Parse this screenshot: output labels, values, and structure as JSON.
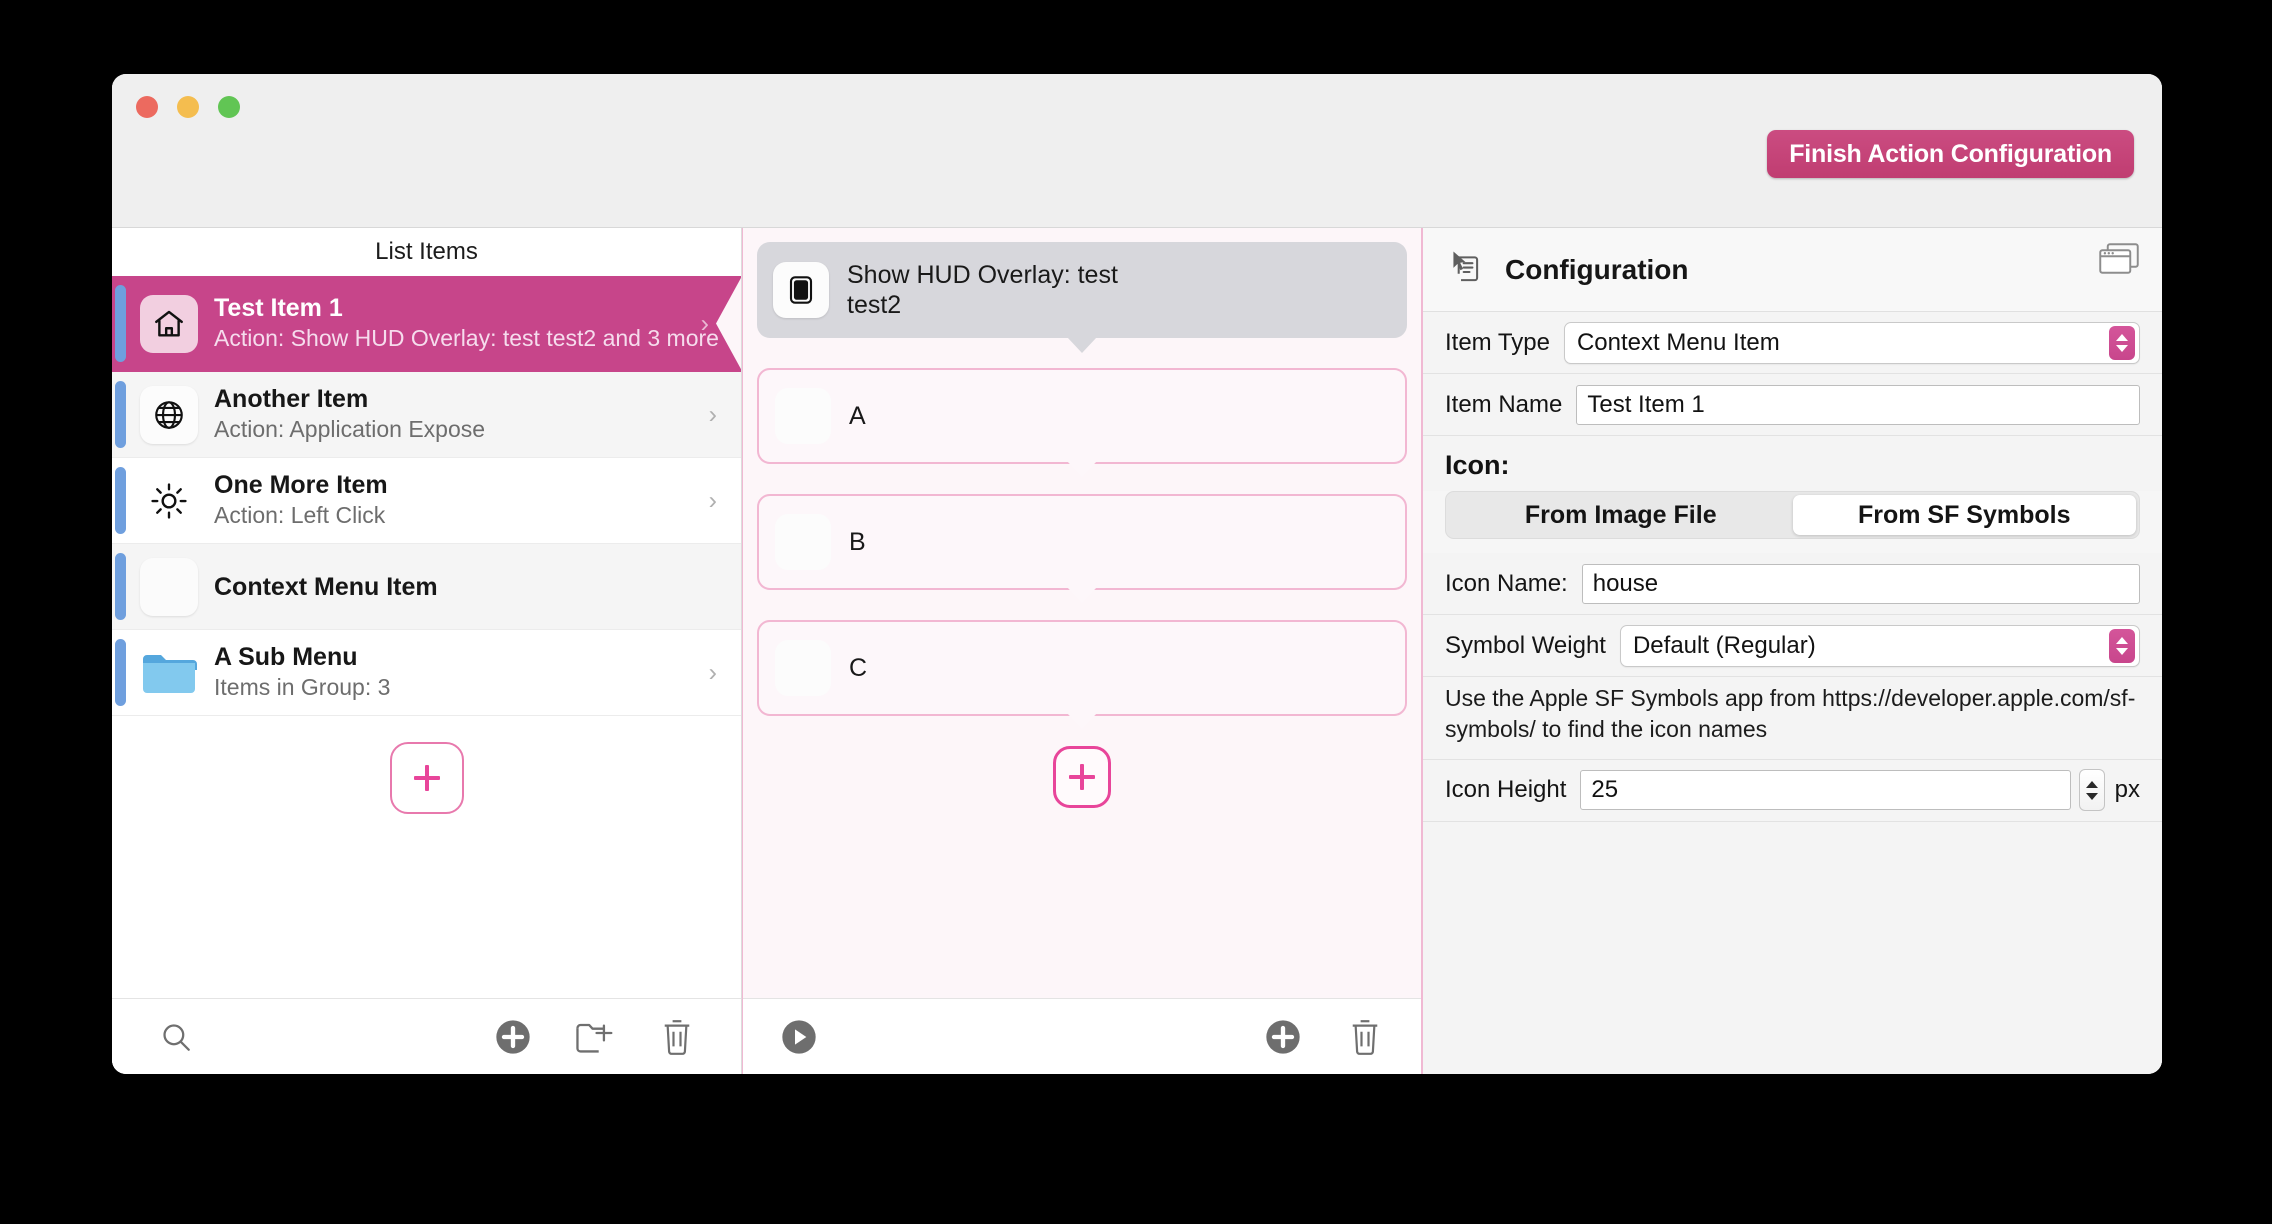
{
  "window": {
    "traffic_lights": [
      "close",
      "minimize",
      "zoom"
    ],
    "finish_button_label": "Finish Action Configuration"
  },
  "left_pane": {
    "header": "List Items",
    "rows": [
      {
        "title": "Test Item 1",
        "subtitle": "Action: Show HUD Overlay: test\ntest2 and 3 more",
        "icon": "house-icon",
        "selected": true,
        "chevron": "›"
      },
      {
        "title": "Another Item",
        "subtitle": "Action: Application Expose",
        "icon": "globe-icon",
        "selected": false,
        "chevron": "›"
      },
      {
        "title": "One More Item",
        "subtitle": "Action: Left Click",
        "icon": "sun-icon",
        "selected": false,
        "chevron": "›"
      },
      {
        "title": "Context Menu Item",
        "subtitle": "",
        "icon": "blank-icon",
        "selected": false,
        "chevron": ""
      },
      {
        "title": "A Sub Menu",
        "subtitle": "Items in Group: 3",
        "icon": "folder-icon",
        "selected": false,
        "chevron": "›"
      }
    ],
    "add_item_button": "+",
    "toolbar": {
      "search": "search-icon",
      "add": "add-circle-icon",
      "new_group": "folder-add-icon",
      "delete": "trash-icon"
    }
  },
  "middle_pane": {
    "nodes": [
      {
        "label": "Show HUD Overlay: test\ntest2",
        "icon": "hud-rectangle-icon",
        "selected": true
      },
      {
        "label": "A",
        "icon": "blank-icon",
        "selected": false
      },
      {
        "label": "B",
        "icon": "blank-icon",
        "selected": false
      },
      {
        "label": "C",
        "icon": "blank-icon",
        "selected": false
      }
    ],
    "add_action_button": "+",
    "toolbar": {
      "run": "play-icon",
      "add": "add-circle-icon",
      "delete": "trash-icon"
    }
  },
  "config_pane": {
    "title": "Configuration",
    "header_icon": "cursor-list-icon",
    "window_icon": "windows-stack-icon",
    "item_type": {
      "label": "Item Type",
      "value": "Context Menu Item"
    },
    "item_name": {
      "label": "Item Name",
      "value": "Test Item 1"
    },
    "icon_heading": "Icon:",
    "icon_source": {
      "options": [
        "From Image File",
        "From SF Symbols"
      ],
      "selected": "From SF Symbols"
    },
    "icon_name": {
      "label": "Icon Name:",
      "value": "house"
    },
    "symbol_weight": {
      "label": "Symbol Weight",
      "value": "Default (Regular)"
    },
    "help_text": "Use the Apple SF Symbols app from https://developer.apple.com/sf-symbols/ to find the icon names",
    "icon_height": {
      "label": "Icon Height",
      "value": "25",
      "unit": "px"
    }
  },
  "colors": {
    "accent_pink": "#c7458a",
    "hot_pink": "#e8459a",
    "row_accent_blue": "#6f9fde",
    "pane_pink_bg": "#fdf6f9"
  }
}
